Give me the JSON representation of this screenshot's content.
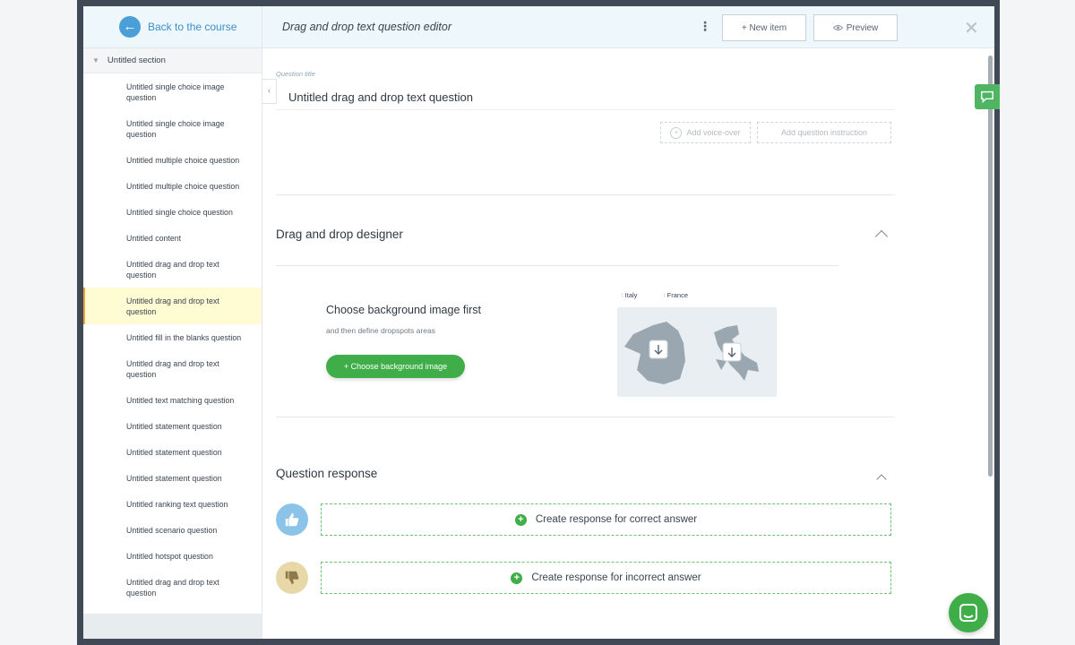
{
  "colors": {
    "accent_blue": "#4a9fd8",
    "accent_green": "#3fae49",
    "active_item_bg": "#fffbd3",
    "active_item_border": "#f0a03c"
  },
  "sidebar": {
    "back_label": "Back to the course",
    "back_icon": "arrow-left-icon",
    "section_label": "Untitled section",
    "items": [
      {
        "label": "Untitled single choice image question",
        "tall": true,
        "active": false
      },
      {
        "label": "Untitled single choice image question",
        "tall": true,
        "active": false
      },
      {
        "label": "Untitled multiple choice question",
        "tall": false,
        "active": false
      },
      {
        "label": "Untitled multiple choice question",
        "tall": false,
        "active": false
      },
      {
        "label": "Untitled single choice question",
        "tall": false,
        "active": false
      },
      {
        "label": "Untitled content",
        "tall": false,
        "active": false
      },
      {
        "label": "Untitled drag and drop text question",
        "tall": true,
        "active": false
      },
      {
        "label": "Untitled drag and drop text question",
        "tall": true,
        "active": true
      },
      {
        "label": "Untitled fill in the blanks question",
        "tall": false,
        "active": false
      },
      {
        "label": "Untitled drag and drop text question",
        "tall": true,
        "active": false
      },
      {
        "label": "Untitled text matching question",
        "tall": false,
        "active": false
      },
      {
        "label": "Untitled statement question",
        "tall": false,
        "active": false
      },
      {
        "label": "Untitled statement question",
        "tall": false,
        "active": false
      },
      {
        "label": "Untitled statement question",
        "tall": false,
        "active": false
      },
      {
        "label": "Untitled ranking text question",
        "tall": false,
        "active": false
      },
      {
        "label": "Untitled scenario question",
        "tall": false,
        "active": false
      },
      {
        "label": "Untitled hotspot question",
        "tall": false,
        "active": false
      },
      {
        "label": "Untitled drag and drop text question",
        "tall": true,
        "active": false
      }
    ]
  },
  "header": {
    "title": "Drag and drop text question editor",
    "new_item_label": "+ New item",
    "preview_label": "Preview",
    "more_icon": "kebab-menu-icon",
    "close_icon": "close-icon"
  },
  "question": {
    "title_caption": "Question title",
    "title": "Untitled drag and drop text question",
    "voice_over_label": "Add voice-over",
    "instruction_label": "Add question instruction"
  },
  "designer": {
    "title": "Drag and drop designer",
    "empty_title": "Choose background image first",
    "empty_subtitle": "and then define dropspots areas",
    "choose_button": "+ Choose background image",
    "chips": [
      "Italy",
      "France"
    ]
  },
  "response": {
    "title": "Question response",
    "correct_label": "Create response for correct answer",
    "incorrect_label": "Create response for incorrect answer"
  }
}
